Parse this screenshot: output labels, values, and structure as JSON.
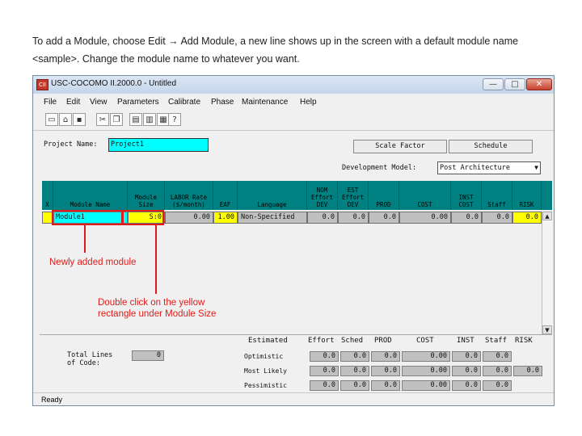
{
  "instructions": {
    "line1": "To add a Module, choose Edit → Add Module, a new line shows up in the screen with a default module name",
    "line2": "<sample>. Change the module name to whatever you want."
  },
  "window": {
    "title": "USC-COCOMO II.2000.0 - Untitled",
    "app_icon": "cocomo-app-icon",
    "minimize": "—",
    "maximize": "□",
    "close": "✕"
  },
  "menu": [
    "File",
    "Edit",
    "View",
    "Parameters",
    "Calibrate",
    "Phase",
    "Maintenance",
    "Help"
  ],
  "toolbar_icons": [
    "new-file-icon",
    "open-folder-icon",
    "save-icon",
    "cut-icon",
    "copy-icon",
    "paste-icon",
    "clipboard-icon",
    "print-icon",
    "help-icon"
  ],
  "project": {
    "name_label": "Project Name:",
    "name_value": "Project1",
    "scale_factor_button": "Scale Factor",
    "schedule_button": "Schedule",
    "dev_model_label": "Development Model:",
    "dev_model_value": "Post Architecture"
  },
  "grid": {
    "headers": [
      "X",
      "Module Name",
      "Module Size",
      "LABOR Rate ($/month)",
      "EAF",
      "Language",
      "NOM Effort DEV",
      "EST Effort DEV",
      "PROD",
      "COST",
      "INST COST",
      "Staff",
      "RISK"
    ],
    "row": {
      "x": "",
      "module_name": "Module1",
      "module_size": "S:0",
      "labor_rate": "0.00",
      "eaf": "1.00",
      "language": "Non-Specified",
      "nom_effort": "0.0",
      "est_effort": "0.0",
      "prod": "0.0",
      "cost": "0.00",
      "inst_cost": "0.0",
      "staff": "0.0",
      "risk": "0.0"
    }
  },
  "annotations": {
    "newly_added": "Newly added module",
    "double_click_1": "Double click on the yellow",
    "double_click_2": "rectangle under Module Size"
  },
  "estimates": {
    "total_lines_label_1": "Total Lines",
    "total_lines_label_2": "of Code:",
    "total_lines_value": "0",
    "headers": [
      "Estimated",
      "Effort",
      "Sched",
      "PROD",
      "COST",
      "INST",
      "Staff",
      "RISK"
    ],
    "rows": [
      {
        "label": "Optimistic",
        "effort": "0.0",
        "sched": "0.0",
        "prod": "0.0",
        "cost": "0.00",
        "inst": "0.0",
        "staff": "0.0",
        "risk": ""
      },
      {
        "label": "Most Likely",
        "effort": "0.0",
        "sched": "0.0",
        "prod": "0.0",
        "cost": "0.00",
        "inst": "0.0",
        "staff": "0.0",
        "risk": "0.0"
      },
      {
        "label": "Pessimistic",
        "effort": "0.0",
        "sched": "0.0",
        "prod": "0.0",
        "cost": "0.00",
        "inst": "0.0",
        "staff": "0.0",
        "risk": ""
      }
    ]
  },
  "status": "Ready"
}
